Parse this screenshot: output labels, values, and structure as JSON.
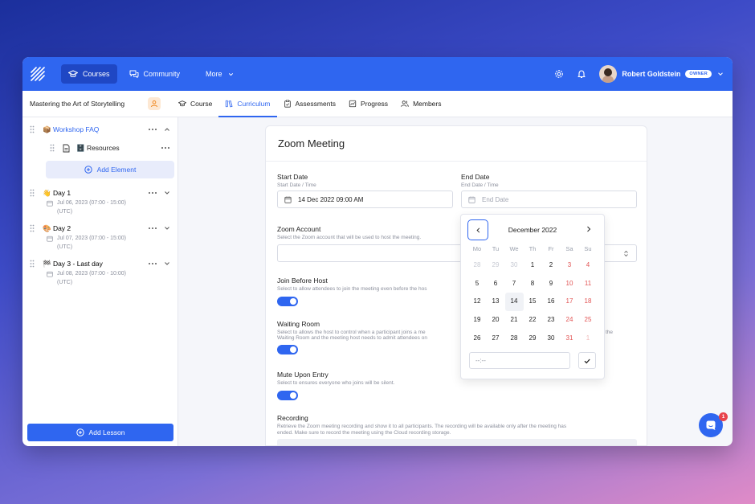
{
  "topbar": {
    "nav": [
      {
        "label": "Courses",
        "icon": "graduation-cap-icon",
        "active": true
      },
      {
        "label": "Community",
        "icon": "chat-bubbles-icon",
        "active": false
      },
      {
        "label": "More",
        "icon": "chevron-down-icon",
        "active": false
      }
    ],
    "user_name": "Robert Goldstein",
    "user_badge": "OWNER"
  },
  "subbar": {
    "course_title": "Mastering the Art of Storytelling",
    "tabs": [
      {
        "label": "Course",
        "icon": "graduation-cap-icon",
        "active": false
      },
      {
        "label": "Curriculum",
        "icon": "books-icon",
        "active": true
      },
      {
        "label": "Assessments",
        "icon": "clipboard-icon",
        "active": false
      },
      {
        "label": "Progress",
        "icon": "chart-icon",
        "active": false
      },
      {
        "label": "Members",
        "icon": "users-icon",
        "active": false
      }
    ]
  },
  "sidebar": {
    "faq": "📦 Workshop FAQ",
    "resources": "🗄️ Resources",
    "add_element": "Add Element",
    "days": [
      {
        "title": "👋 Day 1",
        "date": "Jul 06, 2023 (07:00 - 15:00)",
        "tz": "(UTC)"
      },
      {
        "title": "🎨 Day 2",
        "date": "Jul 07, 2023 (07:00 - 15:00)",
        "tz": "(UTC)"
      },
      {
        "title": "🏁 Day 3 - Last day",
        "date": "Jul 08, 2023 (07:00 - 10:00)",
        "tz": "(UTC)"
      }
    ],
    "add_lesson": "Add Lesson"
  },
  "form": {
    "title": "Zoom Meeting",
    "start_label": "Start Date",
    "start_sub": "Start Date / Time",
    "start_value": "14 Dec 2022 09:00 AM",
    "end_label": "End Date",
    "end_sub": "End Date / Time",
    "end_placeholder": "End Date",
    "zoom_label": "Zoom Account",
    "zoom_sub": "Select the Zoom account that will be used to host the meeting.",
    "jbh_label": "Join Before Host",
    "jbh_sub": "Select to allow attendees to join the meeting even before the hos",
    "wr_label": "Waiting Room",
    "wr_sub1": "Select to allows the host to control when a participant joins a me",
    "wr_sub1_tail": "the",
    "wr_sub2": "Waiting Room and the meeting host needs to admit attendees on",
    "mute_label": "Mute Upon Entry",
    "mute_sub": "Select to ensures everyone who joins will be silent.",
    "rec_label": "Recording",
    "rec_sub1": "Retrieve the Zoom meeting recording and show it to all participants. The recording will be available only after the meeting has",
    "rec_sub2": "ended.  Make sure to record the meeting using the Cloud recording storage."
  },
  "calendar": {
    "month": "December 2022",
    "weekdays": [
      "Mo",
      "Tu",
      "We",
      "Th",
      "Fr",
      "Sa",
      "Su"
    ],
    "weeks": [
      [
        "28",
        "29",
        "30",
        "1",
        "2",
        "3",
        "4"
      ],
      [
        "5",
        "6",
        "7",
        "8",
        "9",
        "10",
        "11"
      ],
      [
        "12",
        "13",
        "14",
        "15",
        "16",
        "17",
        "18"
      ],
      [
        "19",
        "20",
        "21",
        "22",
        "23",
        "24",
        "25"
      ],
      [
        "26",
        "27",
        "28",
        "29",
        "30",
        "31",
        "1"
      ]
    ],
    "time_placeholder": "--:--"
  },
  "chat": {
    "badge": "1"
  },
  "colors": {
    "accent": "#2f66f0",
    "weekend": "#e25555"
  }
}
